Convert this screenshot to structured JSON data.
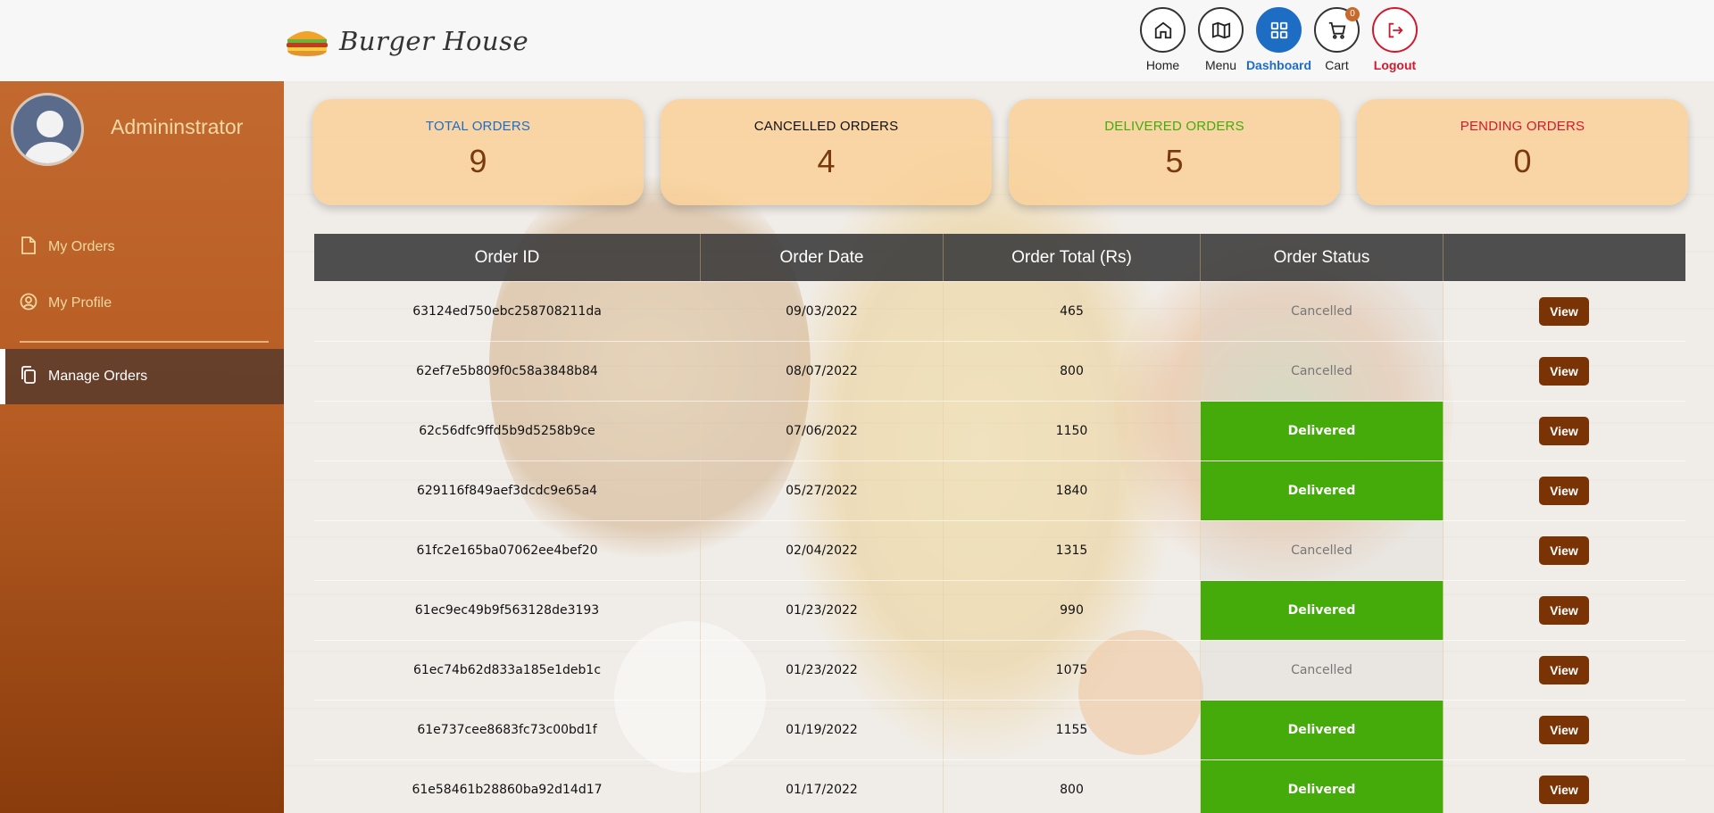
{
  "brand": {
    "title": "Burger House",
    "logo_icon": "burger-icon"
  },
  "nav": [
    {
      "label": "Home",
      "icon": "home-icon"
    },
    {
      "label": "Menu",
      "icon": "map-icon"
    },
    {
      "label": "Dashboard",
      "icon": "grid-icon",
      "active": true
    },
    {
      "label": "Cart",
      "icon": "cart-icon",
      "badge": "0"
    },
    {
      "label": "Logout",
      "icon": "logout-icon"
    }
  ],
  "sidebar": {
    "admin_name": "Admininstrator",
    "items": [
      {
        "label": "My Orders",
        "icon": "file-icon"
      },
      {
        "label": "My Profile",
        "icon": "user-circle-icon"
      },
      {
        "label": "Manage Orders",
        "icon": "copy-icon",
        "active": true
      }
    ]
  },
  "stats": [
    {
      "title": "TOTAL ORDERS",
      "value": "9",
      "color": "#1e6dc5"
    },
    {
      "title": "CANCELLED ORDERS",
      "value": "4",
      "color": "#111111"
    },
    {
      "title": "DELIVERED ORDERS",
      "value": "5",
      "color": "#44ab0b"
    },
    {
      "title": "PENDING ORDERS",
      "value": "0",
      "color": "#d01a2f"
    }
  ],
  "table": {
    "headers": [
      "Order ID",
      "Order Date",
      "Order Total (Rs)",
      "Order Status",
      ""
    ],
    "rows": [
      {
        "id": "63124ed750ebc258708211da",
        "date": "09/03/2022",
        "total": "465",
        "status": "Cancelled",
        "action": "View"
      },
      {
        "id": "62ef7e5b809f0c58a3848b84",
        "date": "08/07/2022",
        "total": "800",
        "status": "Cancelled",
        "action": "View"
      },
      {
        "id": "62c56dfc9ffd5b9d5258b9ce",
        "date": "07/06/2022",
        "total": "1150",
        "status": "Delivered",
        "action": "View"
      },
      {
        "id": "629116f849aef3dcdc9e65a4",
        "date": "05/27/2022",
        "total": "1840",
        "status": "Delivered",
        "action": "View"
      },
      {
        "id": "61fc2e165ba07062ee4bef20",
        "date": "02/04/2022",
        "total": "1315",
        "status": "Cancelled",
        "action": "View"
      },
      {
        "id": "61ec9ec49b9f563128de3193",
        "date": "01/23/2022",
        "total": "990",
        "status": "Delivered",
        "action": "View"
      },
      {
        "id": "61ec74b62d833a185e1deb1c",
        "date": "01/23/2022",
        "total": "1075",
        "status": "Cancelled",
        "action": "View"
      },
      {
        "id": "61e737cee8683fc73c00bd1f",
        "date": "01/19/2022",
        "total": "1155",
        "status": "Delivered",
        "action": "View"
      },
      {
        "id": "61e58461b28860ba92d14d17",
        "date": "01/17/2022",
        "total": "800",
        "status": "Delivered",
        "action": "View"
      }
    ]
  }
}
